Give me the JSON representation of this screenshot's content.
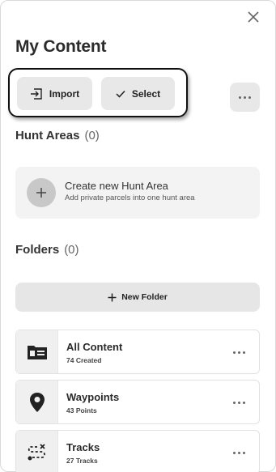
{
  "header": {
    "title": "My Content",
    "close_icon": "close-icon"
  },
  "actions": {
    "import_label": "Import",
    "select_label": "Select",
    "more_icon": "more-horizontal-icon"
  },
  "hunt_areas": {
    "heading": "Hunt Areas",
    "count": "(0)",
    "create_title": "Create new Hunt Area",
    "create_subtitle": "Add private parcels into one hunt area"
  },
  "folders": {
    "heading": "Folders",
    "count": "(0)",
    "new_folder_label": "New Folder"
  },
  "content_list": [
    {
      "title": "All Content",
      "subtitle": "74 Created",
      "icon": "folder-card-icon"
    },
    {
      "title": "Waypoints",
      "subtitle": "43 Points",
      "icon": "map-pin-icon"
    },
    {
      "title": "Tracks",
      "subtitle": "27 Tracks",
      "icon": "track-path-icon"
    }
  ]
}
